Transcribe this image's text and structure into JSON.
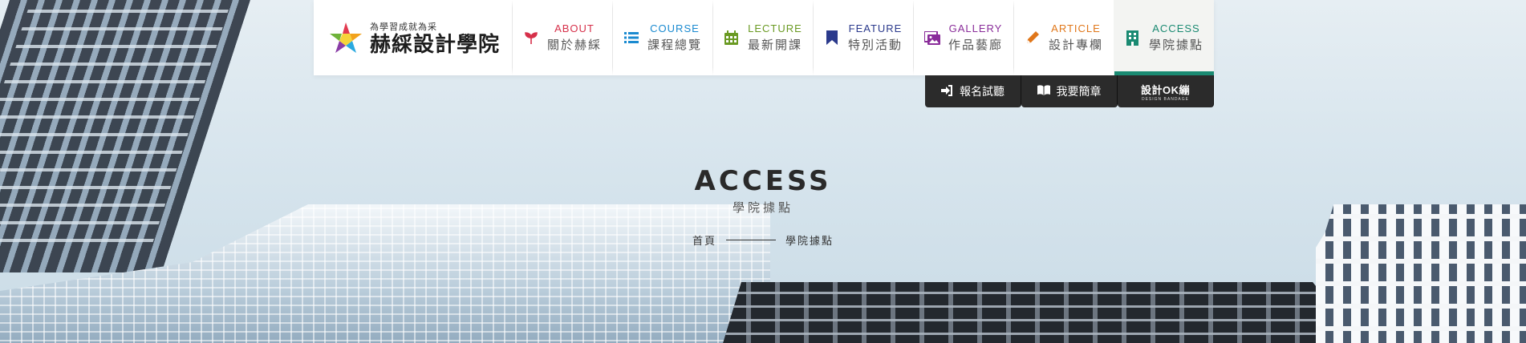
{
  "logo": {
    "slogan": "為學習成就為采",
    "name": "赫綵設計學院"
  },
  "nav": [
    {
      "en": "ABOUT",
      "zh": "關於赫綵",
      "color": "#d6304a",
      "icon": "sprout-icon"
    },
    {
      "en": "COURSE",
      "zh": "課程總覽",
      "color": "#1a8ad0",
      "icon": "list-icon"
    },
    {
      "en": "LECTURE",
      "zh": "最新開課",
      "color": "#6a9a23",
      "icon": "calendar-icon"
    },
    {
      "en": "FEATURE",
      "zh": "特別活動",
      "color": "#2b3a8c",
      "icon": "bookmark-icon"
    },
    {
      "en": "GALLERY",
      "zh": "作品藝廊",
      "color": "#8a2d9a",
      "icon": "images-icon"
    },
    {
      "en": "ARTICLE",
      "zh": "設計專欄",
      "color": "#e0771a",
      "icon": "pencil-icon"
    },
    {
      "en": "ACCESS",
      "zh": "學院據點",
      "color": "#1a8a72",
      "icon": "building-icon",
      "active": true
    }
  ],
  "subbar": {
    "trial": "報名試聽",
    "handbook": "我要簡章",
    "brand_main": "設計OK繃",
    "brand_sub": "DESIGN BANDAGE"
  },
  "page": {
    "title": "ACCESS",
    "subtitle": "學院據點"
  },
  "breadcrumb": {
    "home": "首頁",
    "current": "學院據點"
  }
}
